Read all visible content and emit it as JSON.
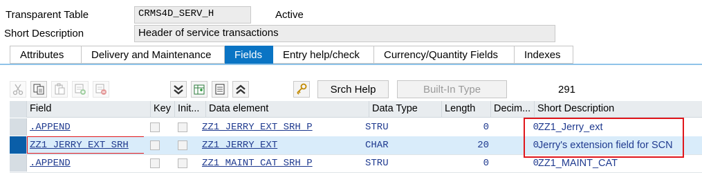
{
  "header": {
    "table_type_label": "Transparent Table",
    "table_name": "CRMS4D_SERV_H",
    "status": "Active",
    "short_desc_label": "Short Description",
    "short_desc_value": "Header of service transactions"
  },
  "tabs": [
    {
      "label": "Attributes",
      "active": false
    },
    {
      "label": "Delivery and Maintenance",
      "active": false
    },
    {
      "label": "Fields",
      "active": true
    },
    {
      "label": "Entry help/check",
      "active": false
    },
    {
      "label": "Currency/Quantity Fields",
      "active": false
    },
    {
      "label": "Indexes",
      "active": false
    }
  ],
  "toolbar": {
    "icons": [
      "cut-icon",
      "copy-icon",
      "paste-icon",
      "insert-row-icon",
      "delete-row-icon",
      "collapse-down-icon",
      "table-new-icon",
      "table-doc-icon",
      "collapse-up-icon",
      "key-search-help-icon"
    ],
    "srch_help_label": "Srch Help",
    "builtin_type_label": "Built-In Type",
    "field_count": "291"
  },
  "table": {
    "columns": [
      "Field",
      "Key",
      "Init...",
      "Data element",
      "Data Type",
      "Length",
      "Decim...",
      "Short Description"
    ],
    "rows": [
      {
        "field": ".APPEND",
        "data_element": "ZZ1_JERRY_EXT_SRH_P",
        "data_type": "STRU",
        "length": "0",
        "decimals": "0",
        "short_desc": "ZZ1_Jerry_ext",
        "selected": false
      },
      {
        "field": "ZZ1_JERRY_EXT_SRH",
        "data_element": "ZZ1_JERRY_EXT",
        "data_type": "CHAR",
        "length": "20",
        "decimals": "0",
        "short_desc": "Jerry's extension field for SCN",
        "selected": true
      },
      {
        "field": ".APPEND",
        "data_element": "ZZ1_MAINT_CAT_SRH_P",
        "data_type": "STRU",
        "length": "0",
        "decimals": "0",
        "short_desc": "ZZ1_MAINT_CAT",
        "selected": false
      }
    ]
  },
  "colors": {
    "accent": "#0a74c4",
    "link": "#1f3a8f",
    "highlight_box": "#e0161b",
    "selected_row": "#d9ecfa"
  }
}
